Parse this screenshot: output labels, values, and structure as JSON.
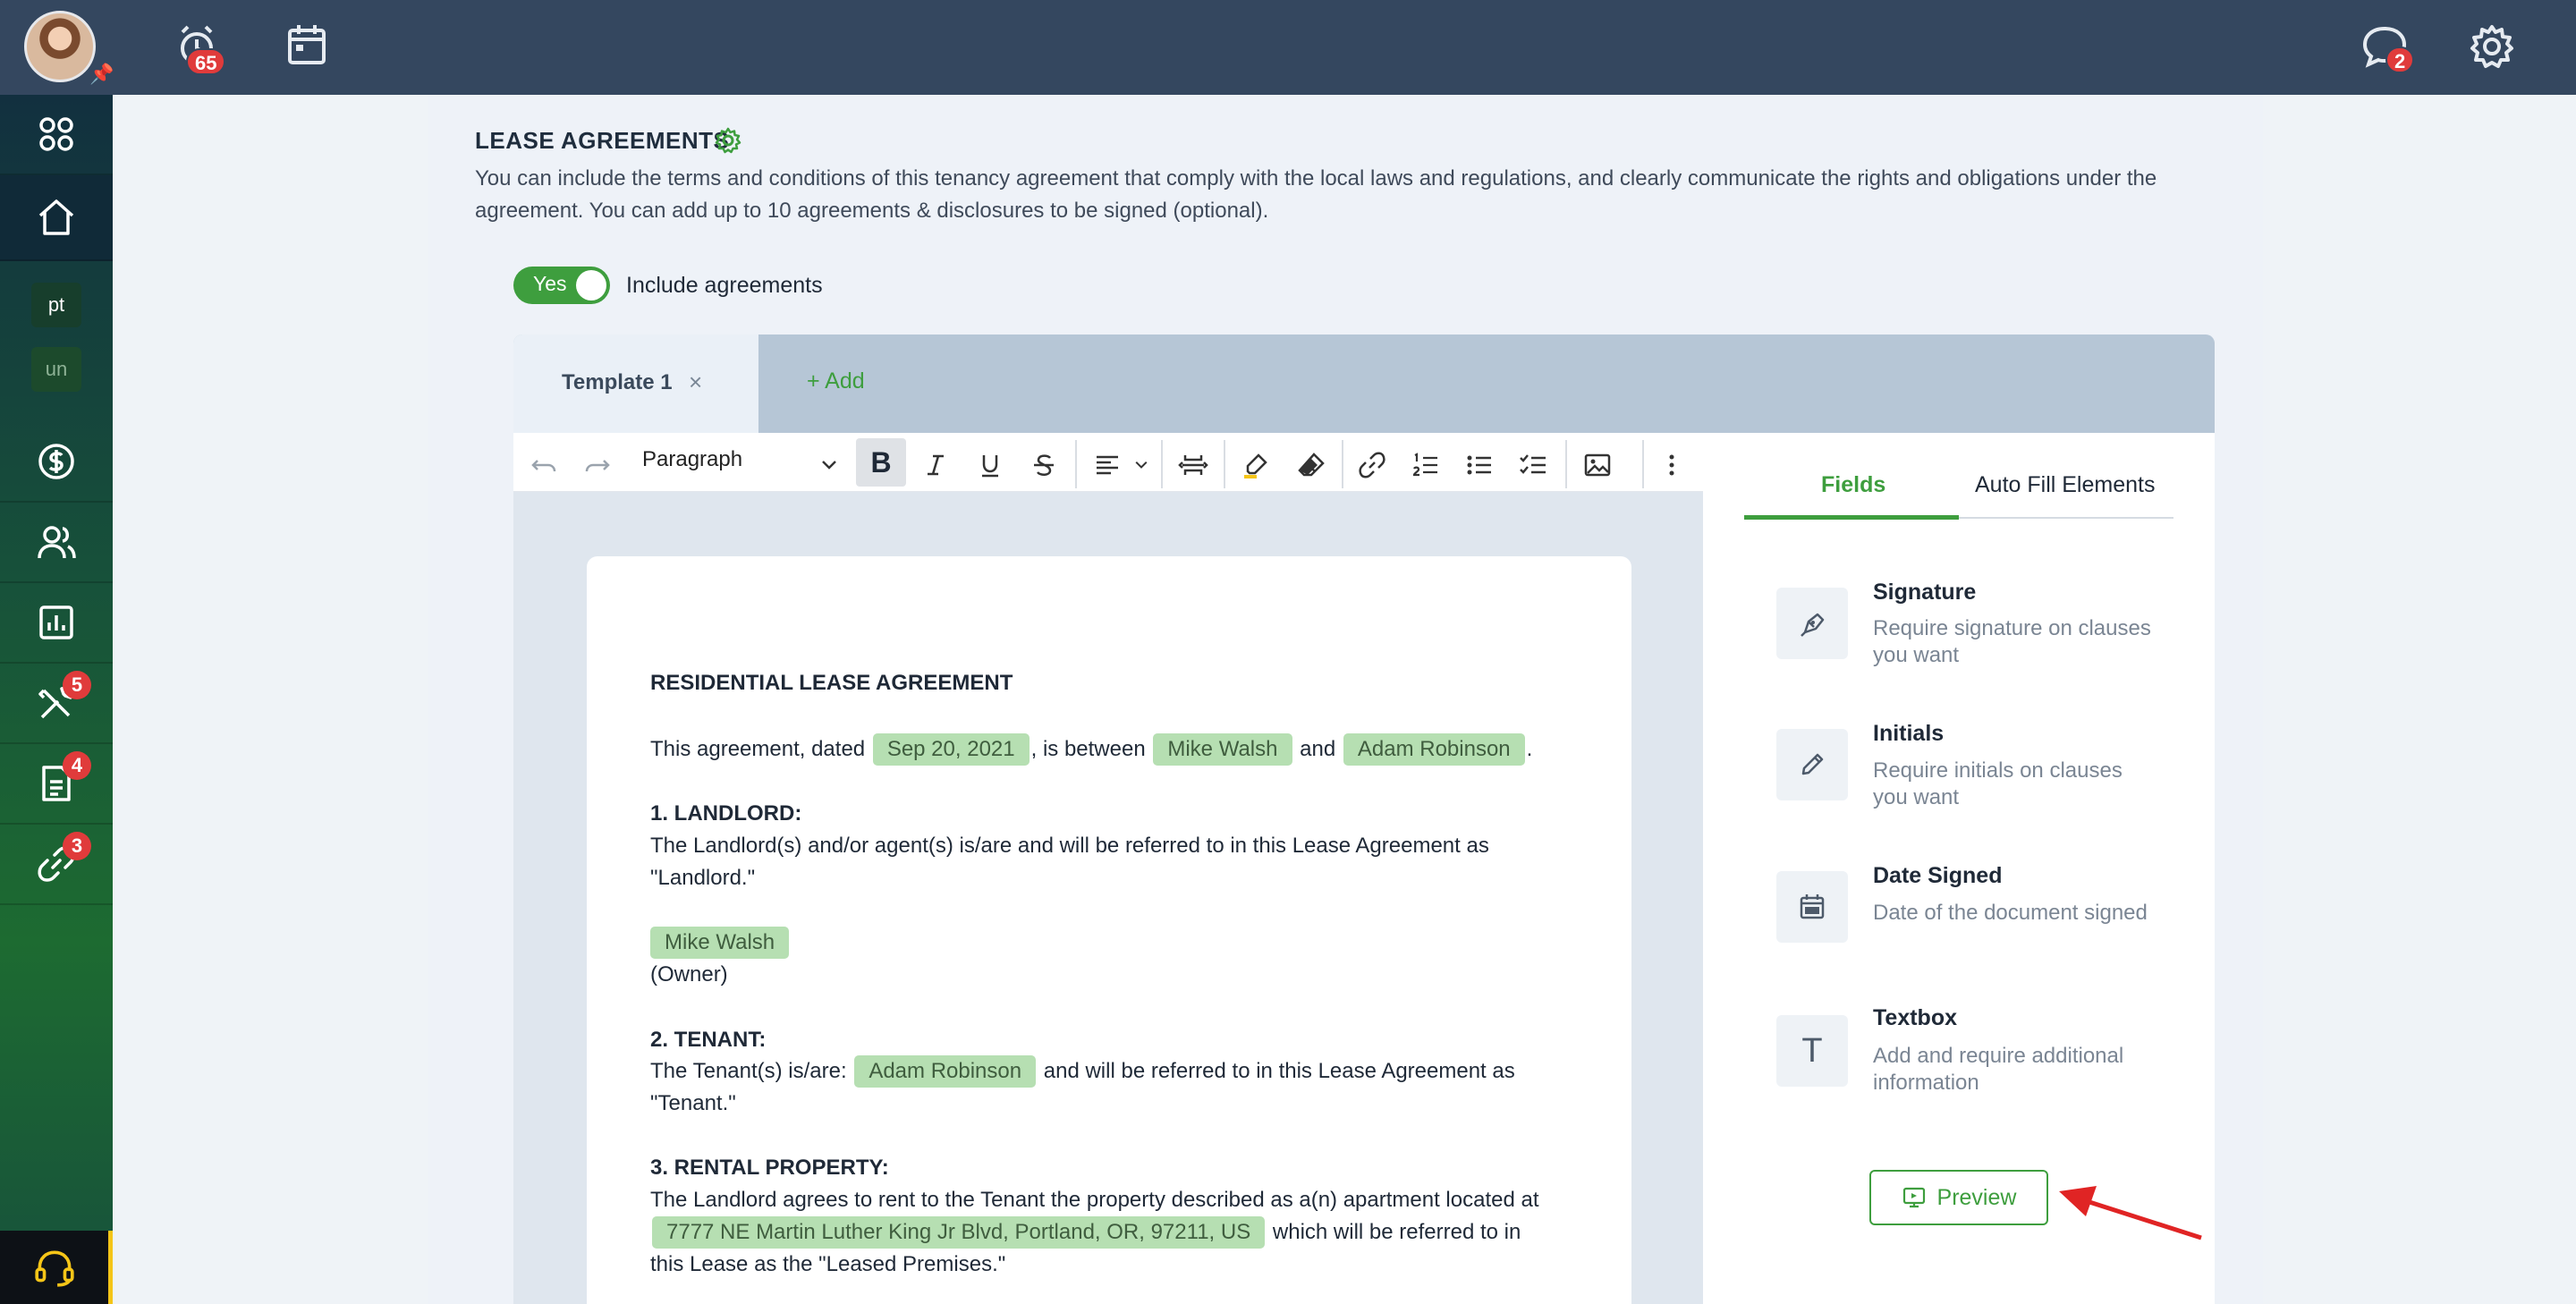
{
  "topbar": {
    "alerts_badge": "65",
    "chat_badge": "2"
  },
  "sidebar": {
    "tags": [
      "pt",
      "un"
    ],
    "badges": {
      "tools": "5",
      "documents": "4",
      "links": "3"
    }
  },
  "section": {
    "title": "LEASE AGREEMENTS",
    "description": "You can include the terms and conditions of this tenancy agreement that comply with the local laws and regulations, and clearly communicate the rights and obligations under the agreement. You can add up to 10 agreements & disclosures to be signed (optional)."
  },
  "toggle": {
    "state_label": "Yes",
    "label": "Include agreements"
  },
  "tabs": {
    "active_label": "Template 1",
    "close": "×",
    "add_label": "+ Add"
  },
  "toolbar": {
    "paragraph": "Paragraph",
    "bold": "B"
  },
  "document": {
    "title": "RESIDENTIAL LEASE AGREEMENT",
    "intro_a": "This agreement, dated ",
    "date": "Sep 20, 2021",
    "intro_b": ", is between ",
    "landlord_name": "Mike Walsh",
    "intro_c": " and ",
    "tenant_name": "Adam Robinson",
    "intro_d": ".",
    "s1_title": "1. LANDLORD:",
    "s1_text": "The Landlord(s) and/or agent(s) is/are and will be referred to in this Lease Agreement as \"Landlord.\"",
    "s1_owner": "(Owner)",
    "s2_title": "2. TENANT:",
    "s2_text_a": "The Tenant(s) is/are: ",
    "s2_text_b": " and will be referred to in this Lease Agreement as \"Tenant.\"",
    "s3_title": "3. RENTAL PROPERTY:",
    "s3_text_a": "The Landlord agrees to rent to the Tenant the property described as a(n) apartment located at ",
    "address": "7777 NE Martin Luther King Jr Blvd, Portland, OR, 97211, US",
    "s3_text_b": " which will be referred to in this Lease as the \"Leased Premises.\""
  },
  "panel": {
    "tab_fields": "Fields",
    "tab_autofill": "Auto Fill Elements",
    "fields": [
      {
        "title": "Signature",
        "desc": "Require signature on clauses you want"
      },
      {
        "title": "Initials",
        "desc": "Require initials on clauses you want"
      },
      {
        "title": "Date Signed",
        "desc": "Date of the document signed"
      },
      {
        "title": "Textbox",
        "desc": "Add and require additional information",
        "glyph": "T"
      }
    ],
    "preview_label": "Preview"
  },
  "colors": {
    "accent": "#3e9e3e",
    "chip": "#b6dfb2",
    "topbar": "#34475f",
    "badge": "#e03b3b"
  }
}
